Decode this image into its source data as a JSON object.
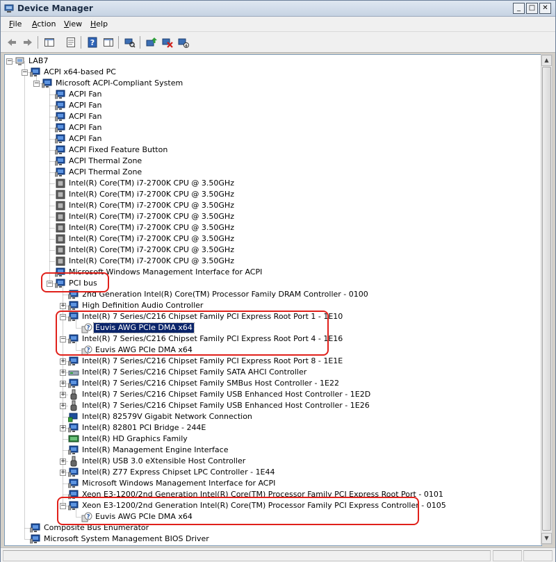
{
  "window": {
    "title": "Device Manager",
    "controls": {
      "minimize": "_",
      "maximize": "□",
      "close": "✕"
    }
  },
  "menubar": [
    {
      "label": "File",
      "mn": "F",
      "rest": "ile"
    },
    {
      "label": "Action",
      "mn": "A",
      "rest": "ction"
    },
    {
      "label": "View",
      "mn": "V",
      "rest": "iew"
    },
    {
      "label": "Help",
      "mn": "H",
      "rest": "elp"
    }
  ],
  "toolbar": {
    "buttons": [
      "back-arrow-icon",
      "forward-arrow-icon",
      "show-hide-console-tree-icon",
      "properties-icon",
      "help-icon",
      "show-hide-action-pane-icon",
      "scan-hardware-changes-icon",
      "update-driver-icon",
      "uninstall-icon",
      "disable-device-icon"
    ]
  },
  "tree": [
    {
      "label": "LAB7",
      "level": 0,
      "exp": "-",
      "icon": "computer-icon"
    },
    {
      "label": "ACPI x64-based PC",
      "level": 1,
      "exp": "-",
      "icon": "monitor-icon"
    },
    {
      "label": "Microsoft ACPI-Compliant System",
      "level": 2,
      "exp": "-",
      "icon": "monitor-icon"
    },
    {
      "label": "ACPI Fan",
      "level": 3,
      "exp": "",
      "icon": "monitor-icon"
    },
    {
      "label": "ACPI Fan",
      "level": 3,
      "exp": "",
      "icon": "monitor-icon"
    },
    {
      "label": "ACPI Fan",
      "level": 3,
      "exp": "",
      "icon": "monitor-icon"
    },
    {
      "label": "ACPI Fan",
      "level": 3,
      "exp": "",
      "icon": "monitor-icon"
    },
    {
      "label": "ACPI Fan",
      "level": 3,
      "exp": "",
      "icon": "monitor-icon"
    },
    {
      "label": "ACPI Fixed Feature Button",
      "level": 3,
      "exp": "",
      "icon": "monitor-icon"
    },
    {
      "label": "ACPI Thermal Zone",
      "level": 3,
      "exp": "",
      "icon": "monitor-icon"
    },
    {
      "label": "ACPI Thermal Zone",
      "level": 3,
      "exp": "",
      "icon": "monitor-icon"
    },
    {
      "label": "Intel(R) Core(TM) i7-2700K CPU @ 3.50GHz",
      "level": 3,
      "exp": "",
      "icon": "processor-icon"
    },
    {
      "label": "Intel(R) Core(TM) i7-2700K CPU @ 3.50GHz",
      "level": 3,
      "exp": "",
      "icon": "processor-icon"
    },
    {
      "label": "Intel(R) Core(TM) i7-2700K CPU @ 3.50GHz",
      "level": 3,
      "exp": "",
      "icon": "processor-icon"
    },
    {
      "label": "Intel(R) Core(TM) i7-2700K CPU @ 3.50GHz",
      "level": 3,
      "exp": "",
      "icon": "processor-icon"
    },
    {
      "label": "Intel(R) Core(TM) i7-2700K CPU @ 3.50GHz",
      "level": 3,
      "exp": "",
      "icon": "processor-icon"
    },
    {
      "label": "Intel(R) Core(TM) i7-2700K CPU @ 3.50GHz",
      "level": 3,
      "exp": "",
      "icon": "processor-icon"
    },
    {
      "label": "Intel(R) Core(TM) i7-2700K CPU @ 3.50GHz",
      "level": 3,
      "exp": "",
      "icon": "processor-icon"
    },
    {
      "label": "Intel(R) Core(TM) i7-2700K CPU @ 3.50GHz",
      "level": 3,
      "exp": "",
      "icon": "processor-icon"
    },
    {
      "label": "Microsoft Windows Management Interface for ACPI",
      "level": 3,
      "exp": "",
      "icon": "monitor-icon"
    },
    {
      "label": "PCI bus",
      "level": 3,
      "exp": "-",
      "icon": "monitor-icon"
    },
    {
      "label": "2nd Generation Intel(R) Core(TM) Processor Family DRAM Controller - 0100",
      "level": 4,
      "exp": "",
      "icon": "monitor-icon"
    },
    {
      "label": "High Definition Audio Controller",
      "level": 4,
      "exp": "+",
      "icon": "monitor-icon"
    },
    {
      "label": "Intel(R) 7 Series/C216 Chipset Family PCI Express Root Port 1 - 1E10",
      "level": 4,
      "exp": "-",
      "icon": "monitor-icon"
    },
    {
      "label": "Euvis AWG PCIe DMA x64",
      "level": 5,
      "exp": "",
      "icon": "unknown-device-icon",
      "selected": true
    },
    {
      "label": "Intel(R) 7 Series/C216 Chipset Family PCI Express Root Port 4 - 1E16",
      "level": 4,
      "exp": "-",
      "icon": "monitor-icon"
    },
    {
      "label": "Euvis AWG PCIe DMA x64",
      "level": 5,
      "exp": "",
      "icon": "unknown-device-icon"
    },
    {
      "label": "Intel(R) 7 Series/C216 Chipset Family PCI Express Root Port 8 - 1E1E",
      "level": 4,
      "exp": "+",
      "icon": "monitor-icon"
    },
    {
      "label": "Intel(R) 7 Series/C216 Chipset Family SATA AHCI Controller",
      "level": 4,
      "exp": "+",
      "icon": "storage-controller-icon"
    },
    {
      "label": "Intel(R) 7 Series/C216 Chipset Family SMBus Host Controller - 1E22",
      "level": 4,
      "exp": "+",
      "icon": "monitor-icon"
    },
    {
      "label": "Intel(R) 7 Series/C216 Chipset Family USB Enhanced Host Controller - 1E2D",
      "level": 4,
      "exp": "+",
      "icon": "usb-icon"
    },
    {
      "label": "Intel(R) 7 Series/C216 Chipset Family USB Enhanced Host Controller - 1E26",
      "level": 4,
      "exp": "+",
      "icon": "usb-icon"
    },
    {
      "label": "Intel(R) 82579V Gigabit Network Connection",
      "level": 4,
      "exp": "",
      "icon": "network-adapter-icon"
    },
    {
      "label": "Intel(R) 82801 PCI Bridge - 244E",
      "level": 4,
      "exp": "+",
      "icon": "monitor-icon"
    },
    {
      "label": "Intel(R) HD Graphics Family",
      "level": 4,
      "exp": "",
      "icon": "display-adapter-icon"
    },
    {
      "label": "Intel(R) Management Engine Interface",
      "level": 4,
      "exp": "",
      "icon": "monitor-icon"
    },
    {
      "label": "Intel(R) USB 3.0 eXtensible Host Controller",
      "level": 4,
      "exp": "+",
      "icon": "usb-icon"
    },
    {
      "label": "Intel(R) Z77 Express Chipset LPC Controller - 1E44",
      "level": 4,
      "exp": "+",
      "icon": "monitor-icon"
    },
    {
      "label": "Microsoft Windows Management Interface for ACPI",
      "level": 4,
      "exp": "",
      "icon": "monitor-icon"
    },
    {
      "label": "Xeon E3-1200/2nd Generation Intel(R) Core(TM) Processor Family PCI Express Root Port - 0101",
      "level": 4,
      "exp": "",
      "icon": "monitor-icon"
    },
    {
      "label": "Xeon E3-1200/2nd Generation Intel(R) Core(TM) Processor Family PCI Express Controller - 0105",
      "level": 4,
      "exp": "-",
      "icon": "monitor-icon"
    },
    {
      "label": "Euvis AWG PCIe DMA x64",
      "level": 5,
      "exp": "",
      "icon": "unknown-device-icon"
    },
    {
      "label": "Composite Bus Enumerator",
      "level": 1,
      "exp": "",
      "icon": "monitor-icon"
    },
    {
      "label": "Microsoft System Management BIOS Driver",
      "level": 1,
      "exp": "",
      "icon": "monitor-icon"
    }
  ],
  "highlights": [
    "pci-bus-highlight",
    "root-port-1-and-4-highlight",
    "pci-express-controller-0105-highlight"
  ],
  "colors": {
    "highlight": "#e0201a",
    "selection": "#0a246a",
    "titlebar": "#c6d3e3"
  }
}
